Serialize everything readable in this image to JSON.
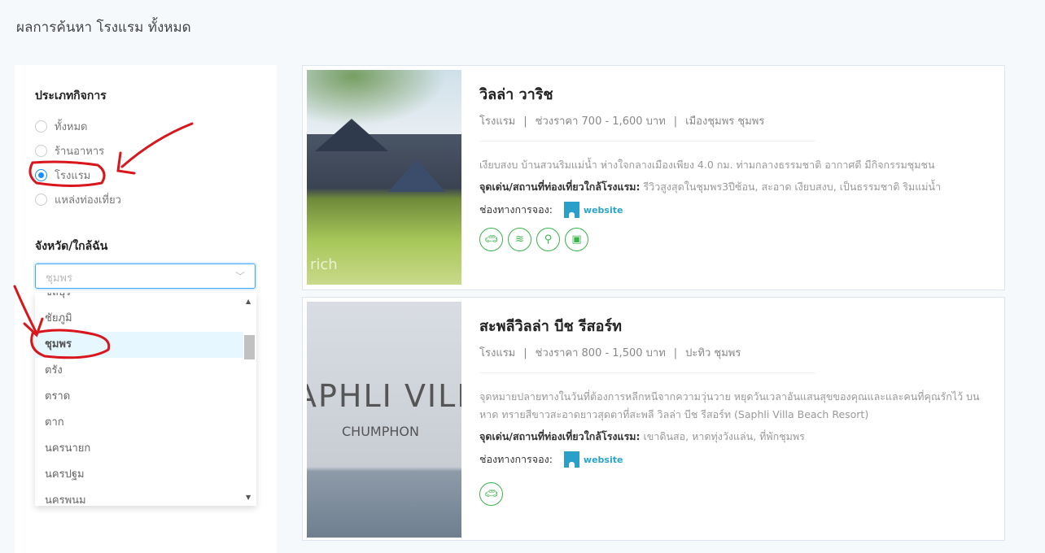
{
  "page_title": "ผลการค้นหา โรงแรม ทั้งหมด",
  "filters": {
    "business_type_title": "ประเภทกิจการ",
    "business_types": [
      {
        "label": "ทั้งหมด",
        "checked": false
      },
      {
        "label": "ร้านอาหาร",
        "checked": false
      },
      {
        "label": "โรงแรม",
        "checked": true
      },
      {
        "label": "แหล่งท่องเที่ยว",
        "checked": false
      }
    ],
    "province_title": "จังหวัด/ใกล้ฉัน",
    "province_value": "ชุมพร",
    "province_options": [
      "ชลบุรี",
      "ชัยภูมิ",
      "ชุมพร",
      "ตรัง",
      "ตราด",
      "ตาก",
      "นครนายก",
      "นครปฐม",
      "นครพนม"
    ],
    "highlighted_option": "ชุมพร"
  },
  "results": [
    {
      "name": "วิลล่า วาริช",
      "type": "โรงแรม",
      "price": "ช่วงราคา 700 - 1,600 บาท",
      "location": "เมืองชุมพร ชุมพร",
      "description": "เงียบสงบ บ้านสวนริมแม่น้ำ ห่างใจกลางเมืองเพียง 4.0 กม. ท่ามกลางธรรมชาติ อากาศดี มีกิจกรรมชุมชน",
      "highlight_label": "จุดเด่น/สถานที่ท่องเที่ยวใกล้โรงแรม:",
      "highlight": "รีวิวสูงสุดในชุมพร3ปีซ้อน, สะอาด เงียบสงบ, เป็นธรรมชาติ ริมแม่น้ำ",
      "booking_label": "ช่องทางการจอง:",
      "booking_link": "website",
      "photo_watermark": "rich",
      "amenities": [
        "car-icon",
        "wifi-icon",
        "bicycle-icon",
        "washing-machine-icon"
      ]
    },
    {
      "name": "สะพลีวิลล่า บีช รีสอร์ท",
      "type": "โรงแรม",
      "price": "ช่วงราคา 800 - 1,500 บาท",
      "location": "ปะทิว ชุมพร",
      "description": "จุดหมายปลายทางในวันที่ต้องการหลีกหนีจากความวุ่นวาย หยุดวันเวลาอันแสนสุขของคุณและและคนที่คุณรักไว้ บนหาด ทรายสีขาวสะอาดยาวสุดตาที่สะพลี วิลล่า บีช รีสอร์ท (Saphli Villa Beach Resort)",
      "highlight_label": "จุดเด่น/สถานที่ท่องเที่ยวใกล้โรงแรม:",
      "highlight": "เขาดินสอ, หาดทุ่งวังแล่น, ที่พักชุมพร",
      "booking_label": "ช่องทางการจอง:",
      "booking_link": "website",
      "photo_text": "APHLI VILL",
      "photo_subtext": "CHUMPHON",
      "amenities": [
        "car-icon"
      ]
    }
  ],
  "colors": {
    "accent": "#1890ff",
    "amenity": "#39b54a",
    "link": "#2aa4c8",
    "annotation": "#d9161c"
  }
}
